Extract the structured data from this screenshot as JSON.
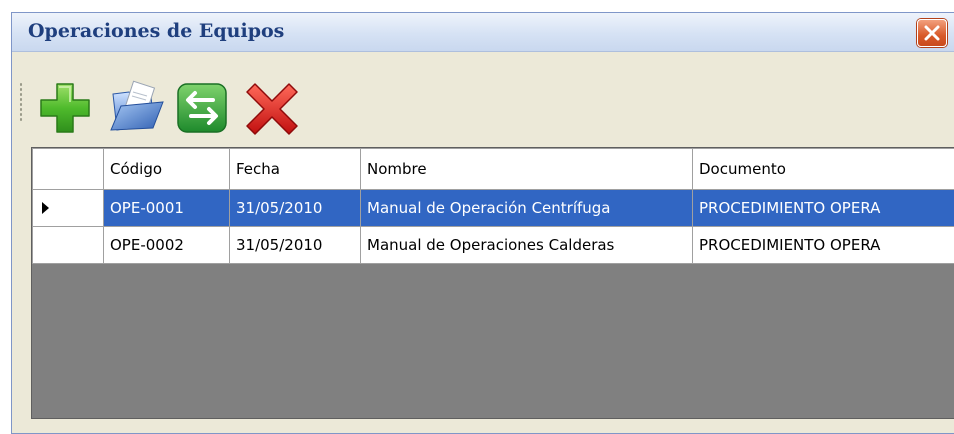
{
  "window": {
    "title": "Operaciones de Equipos"
  },
  "toolbar": {
    "buttons": [
      {
        "icon": "add-icon",
        "color": "#3fae2a"
      },
      {
        "icon": "open-folder-icon",
        "color": "#5b8fd6"
      },
      {
        "icon": "swap-arrows-icon",
        "color": "#2e9e3c"
      },
      {
        "icon": "delete-icon",
        "color": "#d61a1a"
      }
    ]
  },
  "grid": {
    "columns": [
      "Código",
      "Fecha",
      "Nombre",
      "Documento"
    ],
    "rows": [
      {
        "codigo": "OPE-0001",
        "fecha": "31/05/2010",
        "nombre": "Manual de Operación Centrífuga",
        "documento": "PROCEDIMIENTO OPERA",
        "selected": true
      },
      {
        "codigo": "OPE-0002",
        "fecha": "31/05/2010",
        "nombre": "Manual de Operaciones Calderas",
        "documento": "PROCEDIMIENTO OPERA",
        "selected": false
      }
    ],
    "selection_color": "#3166c3",
    "background_color": "#808080"
  }
}
